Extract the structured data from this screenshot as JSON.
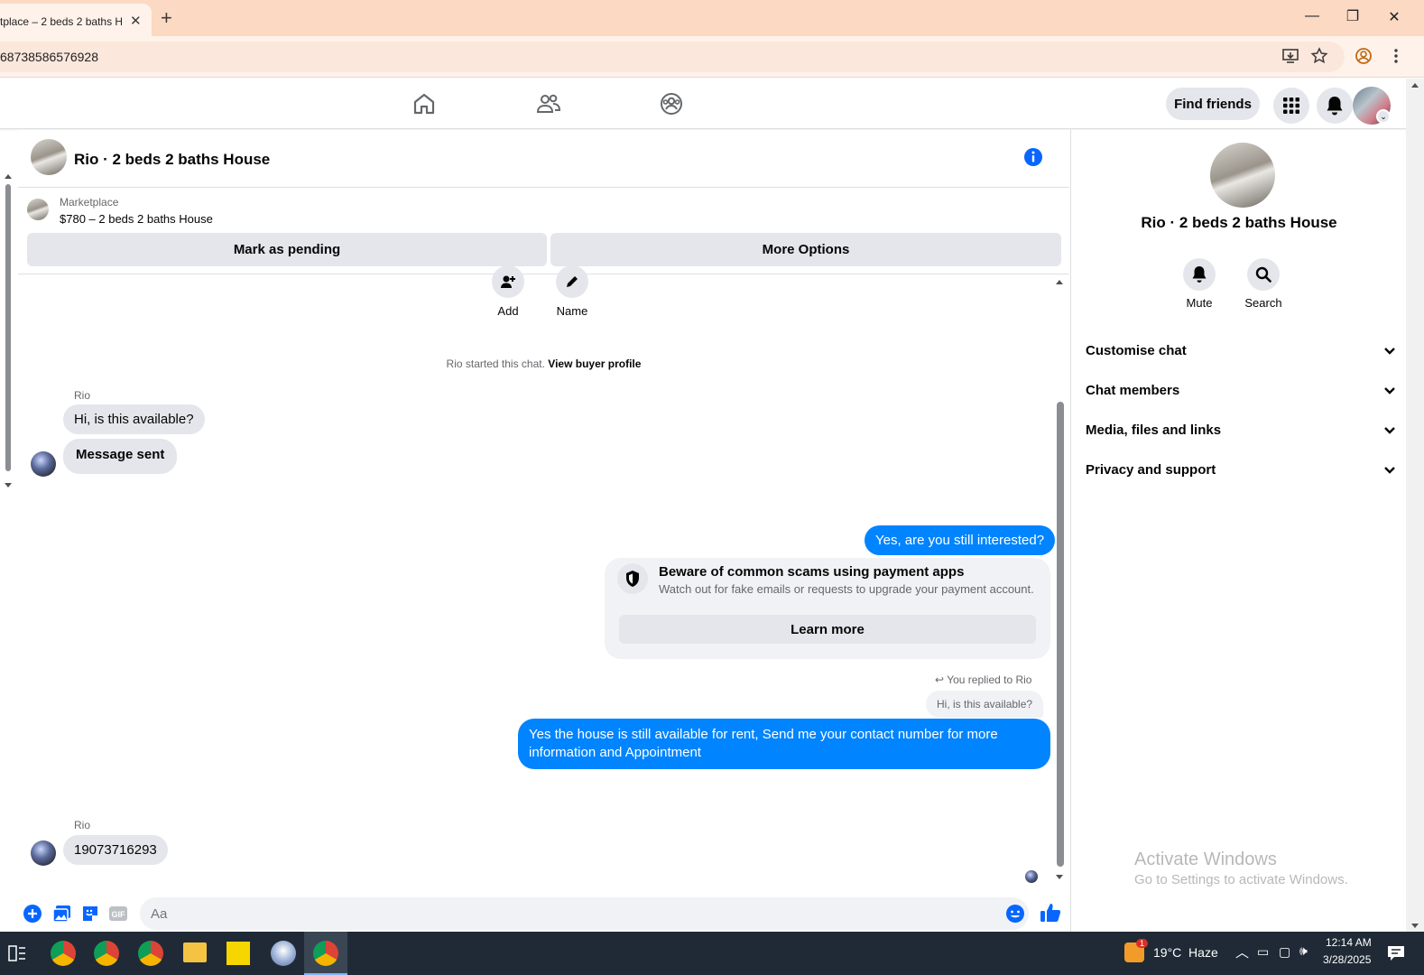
{
  "browser": {
    "tab_title": "tplace – 2 beds 2 baths H",
    "url": "68738586576928",
    "colors": {
      "tabbar": "#fbd9c3",
      "toolbar": "#fff2ea"
    }
  },
  "nav": {
    "find_friends": "Find friends"
  },
  "chat": {
    "title": "Rio · 2 beds 2 baths House",
    "marketplace_label": "Marketplace",
    "listing": "$780 – 2 beds 2 baths House",
    "mark_pending": "Mark as pending",
    "more_options": "More Options",
    "add_label": "Add",
    "name_label": "Name",
    "started_text": "Rio started this chat.",
    "view_buyer": "View buyer profile",
    "sender_name": "Rio",
    "msg1": "Hi, is this available?",
    "msg2": "Message sent",
    "out1": "Yes, are you still interested?",
    "scam_title": "Beware of common scams using payment apps",
    "scam_body": "Watch out for fake emails or requests to upgrade your payment account.",
    "learn_more": "Learn more",
    "replied_to": "You replied to Rio",
    "replied_quote": "Hi, is this available?",
    "out2": "Yes the house is still available for rent, Send me your contact number for more information and Appointment",
    "sender_name2": "Rio",
    "msg3": "19073716293",
    "composer_placeholder": "Aa",
    "colors": {
      "outgoing": "#0084ff",
      "incoming": "#e4e6eb",
      "accent": "#0866ff"
    }
  },
  "panel": {
    "title": "Rio · 2 beds 2 baths House",
    "mute": "Mute",
    "search": "Search",
    "rows": [
      "Customise chat",
      "Chat members",
      "Media, files and links",
      "Privacy and support"
    ],
    "watermark_title": "Activate Windows",
    "watermark_sub": "Go to Settings to activate Windows."
  },
  "taskbar": {
    "weather": "19°C  Haze",
    "time": "12:14 AM",
    "date": "3/28/2025",
    "badge": "1"
  }
}
